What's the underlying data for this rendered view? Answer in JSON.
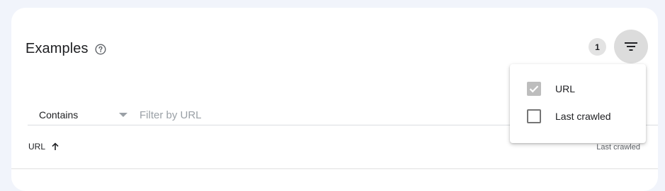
{
  "card": {
    "title": "Examples"
  },
  "filter": {
    "active_count": "1",
    "contains_label": "Contains",
    "input_placeholder": "Filter by URL"
  },
  "table": {
    "columns": [
      "URL",
      "Last crawled"
    ],
    "sort_direction": "ascending"
  },
  "menu": {
    "items": [
      {
        "label": "URL",
        "checked": true
      },
      {
        "label": "Last crawled",
        "checked": false
      }
    ]
  },
  "icons": {
    "help": "help-circle-icon",
    "filter": "filter-list-icon",
    "sort": "arrow-up-icon",
    "check": "check-icon"
  },
  "colors": {
    "page_background": "#f1f4fb",
    "card_background": "#ffffff",
    "filter_button_active": "#dcdcdc",
    "badge_background": "#e3e3e3",
    "checkbox_checked": "#bdbdbd"
  }
}
